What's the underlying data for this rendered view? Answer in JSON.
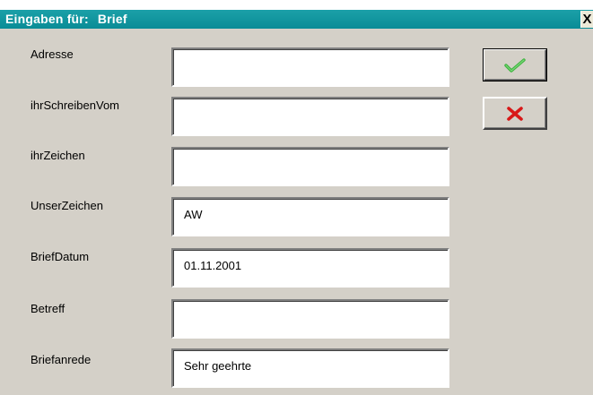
{
  "window": {
    "title_prefix": "Eingaben für:",
    "title_doc": "Brief",
    "close_symbol": "X"
  },
  "fields": [
    {
      "label": "Adresse",
      "value": ""
    },
    {
      "label": "ihrSchreibenVom",
      "value": ""
    },
    {
      "label": "ihrZeichen",
      "value": ""
    },
    {
      "label": "UnserZeichen",
      "value": "AW"
    },
    {
      "label": "BriefDatum",
      "value": "01.11.2001"
    },
    {
      "label": "Betreff",
      "value": ""
    },
    {
      "label": "Briefanrede",
      "value": "Sehr geehrte"
    }
  ],
  "buttons": {
    "ok_icon": "checkmark-icon",
    "cancel_icon": "cross-icon"
  },
  "colors": {
    "titlebar": "#0a8c96",
    "dialog_bg": "#d4d0c8",
    "check_green": "#3cb43c",
    "cross_red": "#d81818"
  }
}
